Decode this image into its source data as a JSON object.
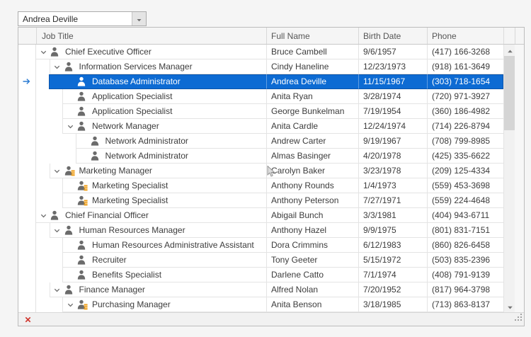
{
  "combobox": {
    "value": "Andrea Deville"
  },
  "grid": {
    "columns": [
      {
        "key": "jobTitle",
        "label": "Job Title"
      },
      {
        "key": "fullName",
        "label": "Full Name"
      },
      {
        "key": "birthDate",
        "label": "Birth Date"
      },
      {
        "key": "phone",
        "label": "Phone"
      }
    ],
    "rows": [
      {
        "level": 0,
        "expandable": true,
        "badge": false,
        "selected": false,
        "jobTitle": "Chief Executive Officer",
        "fullName": "Bruce Cambell",
        "birthDate": "9/6/1957",
        "phone": "(417) 166-3268"
      },
      {
        "level": 1,
        "expandable": true,
        "badge": false,
        "selected": false,
        "jobTitle": "Information Services Manager",
        "fullName": "Cindy Haneline",
        "birthDate": "12/23/1973",
        "phone": "(918) 161-3649"
      },
      {
        "level": 2,
        "expandable": false,
        "badge": false,
        "selected": true,
        "jobTitle": "Database Administrator",
        "fullName": "Andrea Deville",
        "birthDate": "11/15/1967",
        "phone": "(303) 718-1654"
      },
      {
        "level": 2,
        "expandable": false,
        "badge": false,
        "selected": false,
        "jobTitle": "Application Specialist",
        "fullName": "Anita Ryan",
        "birthDate": "3/28/1974",
        "phone": "(720) 971-3927"
      },
      {
        "level": 2,
        "expandable": false,
        "badge": false,
        "selected": false,
        "jobTitle": "Application Specialist",
        "fullName": "George Bunkelman",
        "birthDate": "7/19/1954",
        "phone": "(360) 186-4982"
      },
      {
        "level": 2,
        "expandable": true,
        "badge": false,
        "selected": false,
        "jobTitle": "Network Manager",
        "fullName": "Anita Cardle",
        "birthDate": "12/24/1974",
        "phone": "(714) 226-8794"
      },
      {
        "level": 3,
        "expandable": false,
        "badge": false,
        "selected": false,
        "jobTitle": "Network Administrator",
        "fullName": "Andrew Carter",
        "birthDate": "9/19/1967",
        "phone": "(708) 799-8985"
      },
      {
        "level": 3,
        "expandable": false,
        "badge": false,
        "selected": false,
        "jobTitle": "Network Administrator",
        "fullName": "Almas Basinger",
        "birthDate": "4/20/1978",
        "phone": "(425) 335-6622"
      },
      {
        "level": 1,
        "expandable": true,
        "badge": true,
        "selected": false,
        "jobTitle": "Marketing Manager",
        "fullName": "Carolyn Baker",
        "birthDate": "3/23/1978",
        "phone": "(209) 125-4334"
      },
      {
        "level": 2,
        "expandable": false,
        "badge": true,
        "selected": false,
        "jobTitle": "Marketing Specialist",
        "fullName": "Anthony Rounds",
        "birthDate": "1/4/1973",
        "phone": "(559) 453-3698"
      },
      {
        "level": 2,
        "expandable": false,
        "badge": true,
        "selected": false,
        "jobTitle": "Marketing Specialist",
        "fullName": "Anthony Peterson",
        "birthDate": "7/27/1971",
        "phone": "(559) 224-4648"
      },
      {
        "level": 0,
        "expandable": true,
        "badge": false,
        "selected": false,
        "jobTitle": "Chief Financial Officer",
        "fullName": "Abigail Bunch",
        "birthDate": "3/3/1981",
        "phone": "(404) 943-6711"
      },
      {
        "level": 1,
        "expandable": true,
        "badge": false,
        "selected": false,
        "jobTitle": "Human Resources Manager",
        "fullName": "Anthony Hazel",
        "birthDate": "9/9/1975",
        "phone": "(801) 831-7151"
      },
      {
        "level": 2,
        "expandable": false,
        "badge": false,
        "selected": false,
        "jobTitle": "Human Resources Administrative Assistant",
        "fullName": "Dora Crimmins",
        "birthDate": "6/12/1983",
        "phone": "(860) 826-6458"
      },
      {
        "level": 2,
        "expandable": false,
        "badge": false,
        "selected": false,
        "jobTitle": "Recruiter",
        "fullName": "Tony Geeter",
        "birthDate": "5/15/1972",
        "phone": "(503) 835-2396"
      },
      {
        "level": 2,
        "expandable": false,
        "badge": false,
        "selected": false,
        "jobTitle": "Benefits Specialist",
        "fullName": "Darlene Catto",
        "birthDate": "7/1/1974",
        "phone": "(408) 791-9139"
      },
      {
        "level": 1,
        "expandable": true,
        "badge": false,
        "selected": false,
        "jobTitle": "Finance Manager",
        "fullName": "Alfred Nolan",
        "birthDate": "7/20/1952",
        "phone": "(817) 964-3798"
      },
      {
        "level": 2,
        "expandable": true,
        "badge": true,
        "selected": false,
        "jobTitle": "Purchasing Manager",
        "fullName": "Anita Benson",
        "birthDate": "3/18/1985",
        "phone": "(713) 863-8137"
      }
    ]
  },
  "icons": {
    "dropdown_button": "caret-down",
    "expand_node": "chevron-down",
    "employee": "person",
    "employee_with_tasks": "person-orange-bars",
    "focused_row": "arrow-right",
    "scroll_up": "triangle-up",
    "scroll_down": "triangle-down",
    "status_error": "x-mark",
    "resize_grip": "dot-triangle"
  },
  "colors": {
    "selection_bg": "#0d6bd3",
    "selection_border": "#0b55ab",
    "badge_orange": "#f0a11e",
    "error_red": "#d0342c",
    "focus_arrow_blue": "#2a7ad2",
    "grid_line": "#e4e4e4",
    "header_bg": "#f5f5f5"
  }
}
